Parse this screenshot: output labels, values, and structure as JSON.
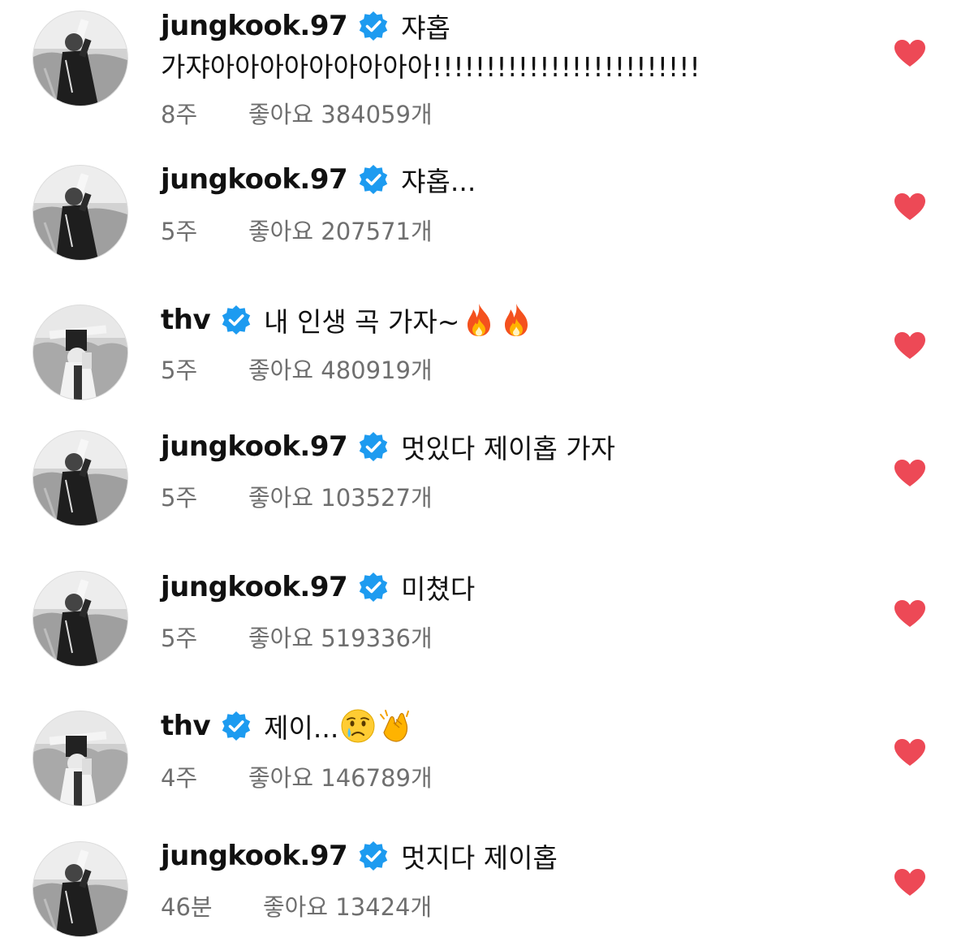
{
  "colors": {
    "heart": "#ed4956",
    "verified": "#1d9bf0",
    "meta_text": "#6f6f6f"
  },
  "icons": {
    "verified": "verified-badge-icon",
    "like": "heart-icon"
  },
  "comments": [
    {
      "username": "jungkook.97",
      "verified": true,
      "text": "쟈홉",
      "text_line2": "가쟈아아아아아아아아아!!!!!!!!!!!!!!!!!!!!!!!!!",
      "time": "8주",
      "likes": "좋아요 384059개",
      "liked": true,
      "avatar": "jungkook"
    },
    {
      "username": "jungkook.97",
      "verified": true,
      "text": "쟈홉...",
      "time": "5주",
      "likes": "좋아요 207571개",
      "liked": true,
      "avatar": "jungkook"
    },
    {
      "username": "thv",
      "verified": true,
      "text": "내 인생 곡 가자~",
      "emoji": [
        "fire",
        "fire"
      ],
      "time": "5주",
      "likes": "좋아요 480919개",
      "liked": true,
      "avatar": "thv"
    },
    {
      "username": "jungkook.97",
      "verified": true,
      "text": "멋있다 제이홉 가자",
      "time": "5주",
      "likes": "좋아요 103527개",
      "liked": true,
      "avatar": "jungkook"
    },
    {
      "username": "jungkook.97",
      "verified": true,
      "text": "미쳤다",
      "time": "5주",
      "likes": "좋아요 519336개",
      "liked": true,
      "avatar": "jungkook"
    },
    {
      "username": "thv",
      "verified": true,
      "text": "제이...",
      "emoji": [
        "crying-face",
        "clapping-hands"
      ],
      "time": "4주",
      "likes": "좋아요 146789개",
      "liked": true,
      "avatar": "thv"
    },
    {
      "username": "jungkook.97",
      "verified": true,
      "text": "멋지다 제이홉",
      "time": "46분",
      "likes": "좋아요 13424개",
      "liked": true,
      "avatar": "jungkook"
    }
  ]
}
